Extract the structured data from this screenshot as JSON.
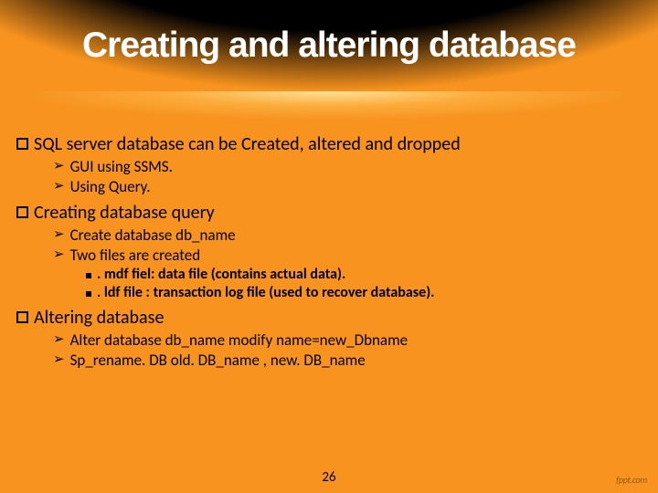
{
  "title": "Creating and altering database",
  "bullets": {
    "b1": "SQL server database can be Created, altered and dropped",
    "b1a": "GUI using SSMS.",
    "b1b": "Using Query.",
    "b2": "Creating database query",
    "b2a": "Create database db_name",
    "b2b": "Two files are created",
    "b2b1": ". mdf fiel: data file (contains actual data).",
    "b2b2": ". ldf file : transaction log file (used to recover database).",
    "b3": "Altering database",
    "b3a": "Alter database db_name modify name=new_Dbname",
    "b3b": "Sp_rename. DB old. DB_name , new. DB_name"
  },
  "page_number": "26",
  "logo": "fppt.com"
}
